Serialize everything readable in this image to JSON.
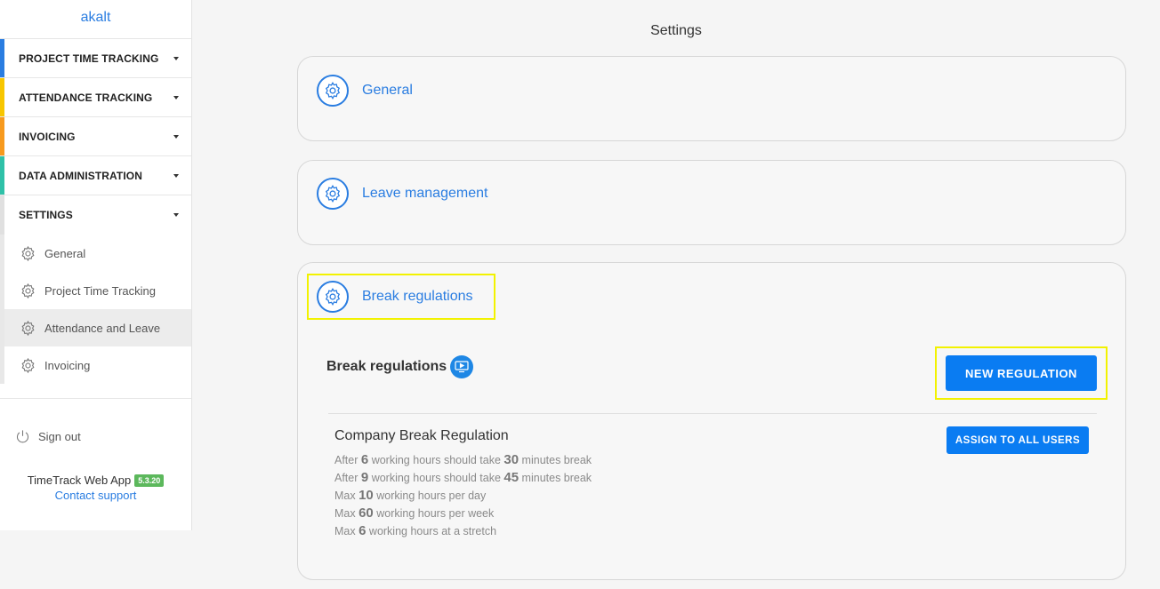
{
  "sidebar": {
    "user": "akalt",
    "nav": [
      {
        "label": "PROJECT TIME TRACKING",
        "color": "#2a7de1"
      },
      {
        "label": "ATTENDANCE TRACKING",
        "color": "#f7c600"
      },
      {
        "label": "INVOICING",
        "color": "#f79a1e"
      },
      {
        "label": "DATA ADMINISTRATION",
        "color": "#2fc1a8"
      },
      {
        "label": "SETTINGS",
        "color": "#e0e0e0"
      }
    ],
    "settings_items": [
      {
        "label": "General",
        "icon": "gear-icon"
      },
      {
        "label": "Project Time Tracking",
        "icon": "gear-icon"
      },
      {
        "label": "Attendance and Leave",
        "icon": "gear-icon",
        "active": true
      },
      {
        "label": "Invoicing",
        "icon": "gear-icon"
      }
    ],
    "sign_out": "Sign out",
    "app_name": "TimeTrack Web App",
    "version": "5.3.20",
    "support": "Contact support"
  },
  "main": {
    "title": "Settings",
    "cards": [
      {
        "title": "General"
      },
      {
        "title": "Leave management"
      },
      {
        "title": "Break regulations"
      }
    ],
    "break_section": {
      "heading": "Break regulations",
      "new_button": "NEW REGULATION",
      "regulation": {
        "name": "Company Break Regulation",
        "assign_button": "ASSIGN TO ALL USERS",
        "rules": [
          {
            "pre": "After ",
            "n1": "6",
            "mid": " working hours should take ",
            "n2": "30",
            "post": " minutes break"
          },
          {
            "pre": "After ",
            "n1": "9",
            "mid": " working hours should take ",
            "n2": "45",
            "post": " minutes break"
          },
          {
            "pre": "Max ",
            "n1": "10",
            "mid": " working hours per day",
            "n2": "",
            "post": ""
          },
          {
            "pre": "Max ",
            "n1": "60",
            "mid": " working hours per week",
            "n2": "",
            "post": ""
          },
          {
            "pre": "Max ",
            "n1": "6",
            "mid": " working hours at a stretch",
            "n2": "",
            "post": ""
          }
        ]
      }
    }
  },
  "colors": {
    "accent": "#2a7de1",
    "button": "#0a7cf2",
    "highlight": "#f2f200"
  }
}
